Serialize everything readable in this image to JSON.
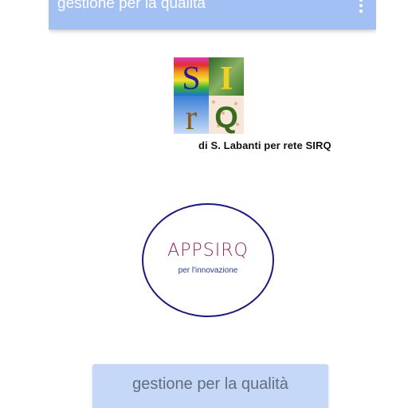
{
  "appbar": {
    "title": "gestione per la qualità",
    "overflow_icon": "more-vert-icon",
    "background_color": "#a3c0f4"
  },
  "logo": {
    "letters": [
      "S",
      "I",
      "r",
      "Q"
    ],
    "credit": "di S. Labanti per rete SIRQ"
  },
  "badge": {
    "title": "APPSIRQ",
    "subtitle": "per l'innovazione",
    "ring_color": "#1a1a7a"
  },
  "main_button": {
    "label": "gestione per la qualità",
    "background_color": "#c6d8f8"
  }
}
